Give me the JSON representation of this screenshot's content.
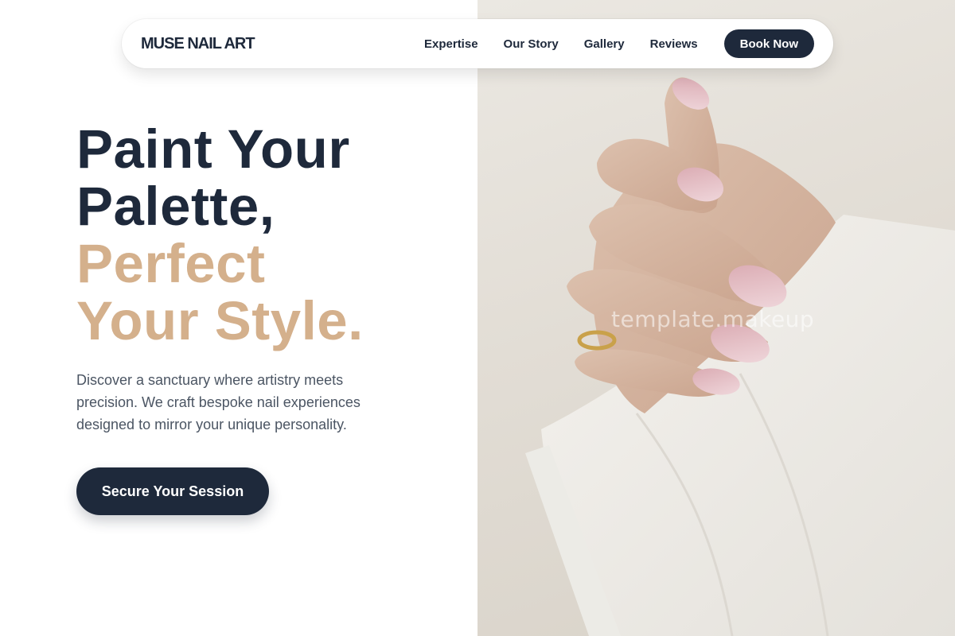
{
  "nav": {
    "brand": "MUSE NAIL ART",
    "links": [
      "Expertise",
      "Our Story",
      "Gallery",
      "Reviews"
    ],
    "cta_label": "Book Now"
  },
  "hero": {
    "headline_line1": "Paint Your",
    "headline_line2": "Palette,",
    "headline_line3": "Perfect",
    "headline_line4": "Your Style.",
    "description": "Discover a sanctuary where artistry meets precision. We craft bespoke nail experiences designed to mirror your unique personality.",
    "cta_label": "Secure Your Session"
  },
  "photo": {
    "watermark": "template.makeup"
  },
  "colors": {
    "primary": "#1e293b",
    "accent": "#d4b08c",
    "body_text": "#4b5563",
    "background": "#ffffff"
  }
}
